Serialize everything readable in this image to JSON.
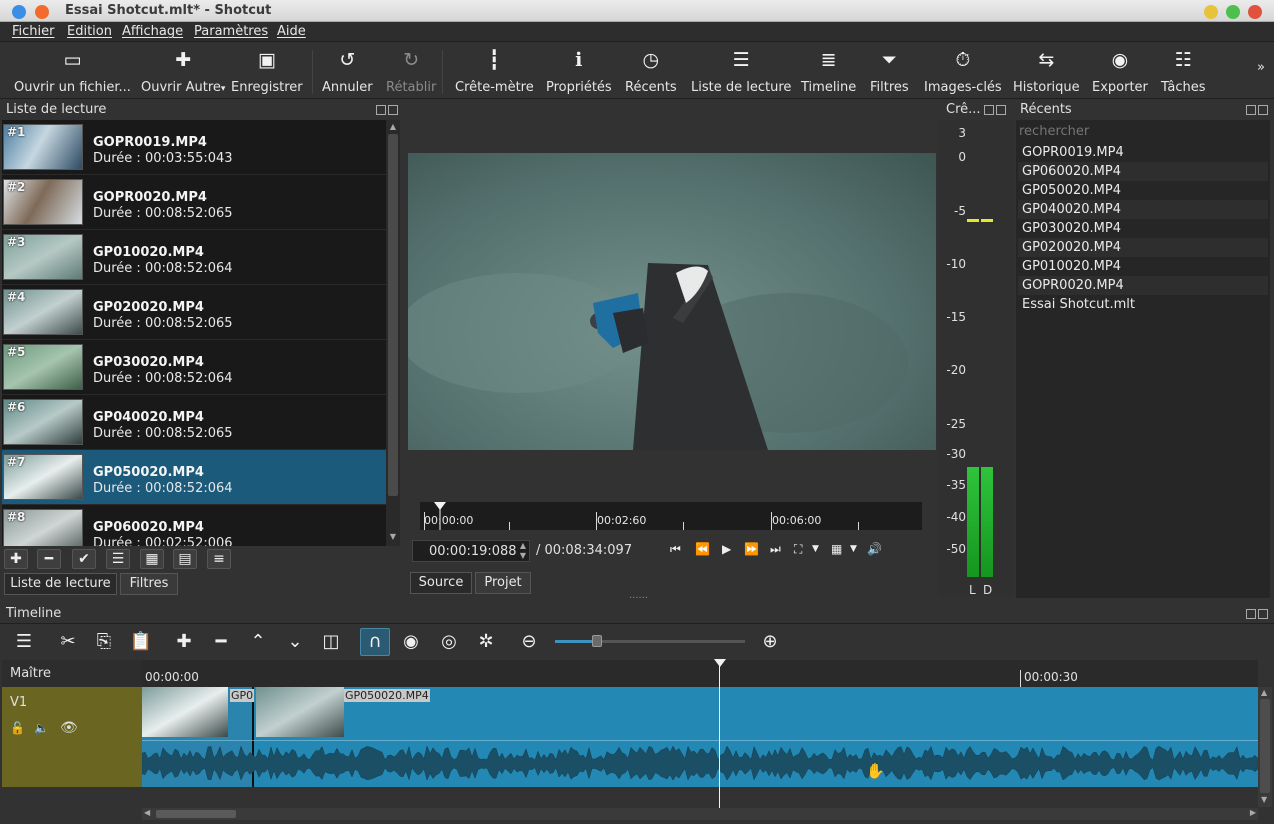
{
  "window": {
    "title": "Essai Shotcut.mlt* - Shotcut"
  },
  "menu": [
    "Fichier",
    "Edition",
    "Affichage",
    "Paramètres",
    "Aide"
  ],
  "toolbar": [
    {
      "label": "Ouvrir un fichier...",
      "icon": "open-file-icon",
      "enabled": true
    },
    {
      "label": "Ouvrir Autre",
      "icon": "open-other-icon",
      "enabled": true
    },
    {
      "label": "Enregistrer",
      "icon": "save-icon",
      "enabled": true
    },
    {
      "label": "Annuler",
      "icon": "undo-icon",
      "enabled": true
    },
    {
      "label": "Rétablir",
      "icon": "redo-icon",
      "enabled": false
    },
    {
      "label": "Crête-mètre",
      "icon": "peak-meter-icon",
      "enabled": true
    },
    {
      "label": "Propriétés",
      "icon": "info-icon",
      "enabled": true
    },
    {
      "label": "Récents",
      "icon": "clock-icon",
      "enabled": true
    },
    {
      "label": "Liste de lecture",
      "icon": "list-icon",
      "enabled": true
    },
    {
      "label": "Timeline",
      "icon": "timeline-icon",
      "enabled": true
    },
    {
      "label": "Filtres",
      "icon": "filter-icon",
      "enabled": true
    },
    {
      "label": "Images-clés",
      "icon": "stopwatch-icon",
      "enabled": true
    },
    {
      "label": "Historique",
      "icon": "history-icon",
      "enabled": true
    },
    {
      "label": "Exporter",
      "icon": "export-icon",
      "enabled": true
    },
    {
      "label": "Tâches",
      "icon": "jobs-icon",
      "enabled": true
    }
  ],
  "playlist": {
    "title": "Liste de lecture",
    "items": [
      {
        "num": "#1",
        "name": "GOPR0019.MP4",
        "duration": "Durée : 00:03:55:043"
      },
      {
        "num": "#2",
        "name": "GOPR0020.MP4",
        "duration": "Durée : 00:08:52:065"
      },
      {
        "num": "#3",
        "name": "GP010020.MP4",
        "duration": "Durée : 00:08:52:064"
      },
      {
        "num": "#4",
        "name": "GP020020.MP4",
        "duration": "Durée : 00:08:52:065"
      },
      {
        "num": "#5",
        "name": "GP030020.MP4",
        "duration": "Durée : 00:08:52:064"
      },
      {
        "num": "#6",
        "name": "GP040020.MP4",
        "duration": "Durée : 00:08:52:065"
      },
      {
        "num": "#7",
        "name": "GP050020.MP4",
        "duration": "Durée : 00:08:52:064",
        "selected": true
      },
      {
        "num": "#8",
        "name": "GP060020.MP4",
        "duration": "Durée : 00:02:52:006"
      }
    ],
    "tabs": [
      "Liste de lecture",
      "Filtres"
    ]
  },
  "player": {
    "timecode": "00:00:19:088",
    "total": "/ 00:08:34:097",
    "ruler_labels": [
      "00:00:00",
      "00:02:60",
      "00:06:00"
    ],
    "tabs": [
      "Source",
      "Projet"
    ]
  },
  "meter": {
    "title": "Crê...",
    "scale": [
      "3",
      "0",
      "-5",
      "-10",
      "-15",
      "-20",
      "-25",
      "-30",
      "-35",
      "-40",
      "-50"
    ],
    "channels": [
      "L",
      "D"
    ]
  },
  "recent": {
    "title": "Récents",
    "search_placeholder": "rechercher",
    "items": [
      "GOPR0019.MP4",
      "GP060020.MP4",
      "GP050020.MP4",
      "GP040020.MP4",
      "GP030020.MP4",
      "GP020020.MP4",
      "GP010020.MP4",
      "GOPR0020.MP4",
      "Essai Shotcut.mlt"
    ]
  },
  "timeline": {
    "title": "Timeline",
    "master": "Maître",
    "track": "V1",
    "ruler": [
      "00:00:00",
      "00:00:30"
    ],
    "clips": [
      {
        "label": "GP0"
      },
      {
        "label": "GP050020.MP4"
      }
    ]
  },
  "colors": {
    "selection": "#1b5a7a",
    "clip": "#2388b3",
    "track_header": "#6a6521",
    "meter_green": "#1aa52a"
  }
}
